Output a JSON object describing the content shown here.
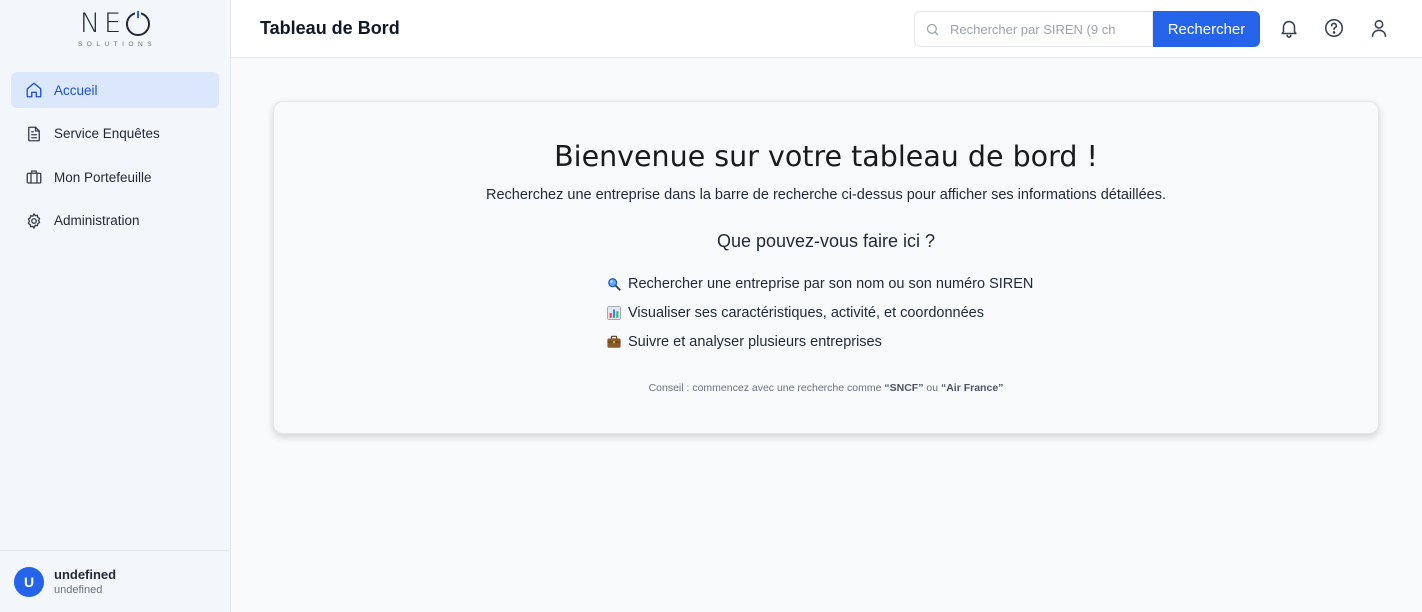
{
  "sidebar": {
    "logo": {
      "word": "NE",
      "subtitle": "SOLUTIONS"
    },
    "items": [
      {
        "label": "Accueil",
        "icon": "home-icon",
        "active": true
      },
      {
        "label": "Service Enquêtes",
        "icon": "file-text-icon",
        "active": false
      },
      {
        "label": "Mon Portefeuille",
        "icon": "briefcase-icon",
        "active": false
      },
      {
        "label": "Administration",
        "icon": "gear-icon",
        "active": false
      }
    ],
    "user": {
      "initial": "U",
      "name": "undefined",
      "subtitle": "undefined"
    }
  },
  "header": {
    "title": "Tableau de Bord",
    "search": {
      "placeholder": "Rechercher par SIREN (9 ch",
      "value": ""
    },
    "search_button": "Rechercher",
    "icons": [
      "bell-icon",
      "help-circle-icon",
      "user-icon"
    ]
  },
  "welcome": {
    "title": "Bienvenue sur votre tableau de bord !",
    "description": "Recherchez une entreprise dans la barre de recherche ci-dessus pour afficher ses informations détaillées.",
    "subtitle": "Que pouvez-vous faire ici ?",
    "features": [
      {
        "icon": "magnifier-emoji-icon",
        "text": "Rechercher une entreprise par son nom ou son numéro SIREN"
      },
      {
        "icon": "bar-chart-emoji-icon",
        "text": "Visualiser ses caractéristiques, activité, et coordonnées"
      },
      {
        "icon": "briefcase-emoji-icon",
        "text": "Suivre et analyser plusieurs entreprises"
      }
    ],
    "tip": {
      "prefix": "Conseil : commencez avec une recherche comme ",
      "example1": "“SNCF”",
      "middle": " ou ",
      "example2": "“Air France”"
    }
  },
  "colors": {
    "accent": "#2563eb",
    "active_bg": "#dbe7fb",
    "page_bg": "#f8fafc"
  }
}
